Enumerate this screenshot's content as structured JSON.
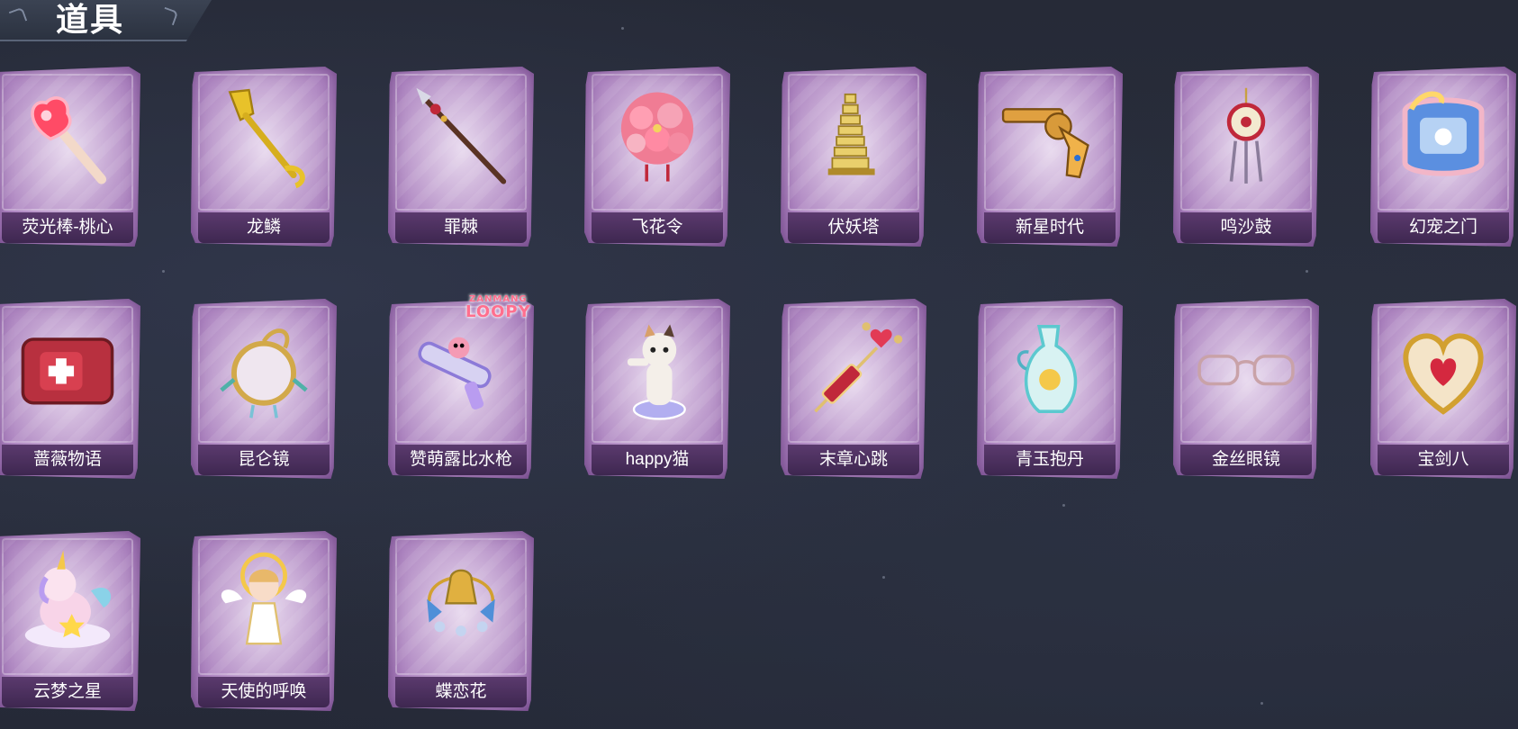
{
  "header": {
    "title": "道具"
  },
  "items": [
    {
      "name": "荧光棒-桃心",
      "icon": "heart-glowstick-icon"
    },
    {
      "name": "龙鳞",
      "icon": "golden-shovel-icon"
    },
    {
      "name": "罪棘",
      "icon": "spear-icon"
    },
    {
      "name": "飞花令",
      "icon": "flower-ball-icon"
    },
    {
      "name": "伏妖塔",
      "icon": "pagoda-icon"
    },
    {
      "name": "新星时代",
      "icon": "revolver-icon"
    },
    {
      "name": "鸣沙鼓",
      "icon": "drum-charm-icon"
    },
    {
      "name": "幻宠之门",
      "icon": "pet-device-icon"
    },
    {
      "name": "蔷薇物语",
      "icon": "medkit-icon"
    },
    {
      "name": "昆仑镜",
      "icon": "mirror-icon"
    },
    {
      "name": "赞萌露比水枪",
      "icon": "water-gun-icon",
      "badge_top": "ZANMANG",
      "badge_bottom": "LOOPY"
    },
    {
      "name": "happy猫",
      "icon": "cat-figure-icon"
    },
    {
      "name": "末章心跳",
      "icon": "heart-syringe-icon"
    },
    {
      "name": "青玉抱丹",
      "icon": "jade-vase-icon"
    },
    {
      "name": "金丝眼镜",
      "icon": "glasses-icon"
    },
    {
      "name": "宝剑八",
      "icon": "heart-locket-icon"
    },
    {
      "name": "云梦之星",
      "icon": "unicorn-icon"
    },
    {
      "name": "天使的呼唤",
      "icon": "angel-figure-icon"
    },
    {
      "name": "蝶恋花",
      "icon": "bell-ornament-icon"
    }
  ],
  "colors": {
    "background": "#272b38",
    "card": "#c8a8d6",
    "label_bar": "#4a2f5e"
  }
}
